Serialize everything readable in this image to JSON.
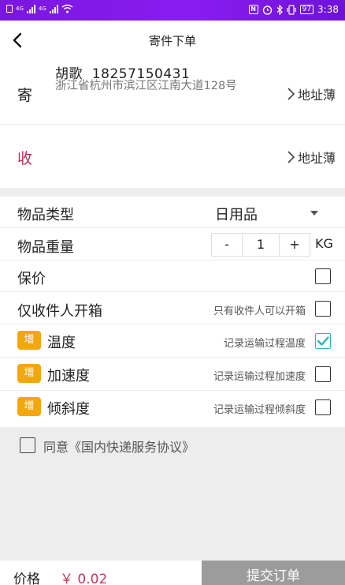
{
  "status_bar": {
    "time": "3:38",
    "battery": "97",
    "net1": "4G",
    "net2": "4G",
    "nfc": "N"
  },
  "header": {
    "title": "寄件下单"
  },
  "sender": {
    "label": "寄",
    "name_phone": "胡歌  18257150431",
    "address": "浙江省杭州市滨江区江南大道128号",
    "address_book": "地址薄"
  },
  "receiver": {
    "label": "收",
    "address_book": "地址薄"
  },
  "item": {
    "type_label": "物品类型",
    "type_value": "日用品",
    "weight_label": "物品重量",
    "weight_minus": "-",
    "weight_value": "1",
    "weight_plus": "+",
    "weight_unit": "KG",
    "insured_label": "保价",
    "insured_checked": false,
    "recipient_only_label": "仅收件人开箱",
    "recipient_only_hint": "只有收件人可以开箱",
    "recipient_only_checked": false
  },
  "addons": [
    {
      "badge": "增",
      "label": "温度",
      "hint": "记录运输过程温度",
      "checked": true
    },
    {
      "badge": "增",
      "label": "加速度",
      "hint": "记录运输过程加速度",
      "checked": false
    },
    {
      "badge": "增",
      "label": "倾斜度",
      "hint": "记录运输过程倾斜度",
      "checked": false
    }
  ],
  "agreement": {
    "text": "同意《国内快递服务协议》",
    "checked": false
  },
  "footer": {
    "price_label": "价格",
    "price_value": "￥ 0.02",
    "submit_label": "提交订单"
  },
  "colors": {
    "status_bar": "#8a1cf0",
    "accent_red": "#c0395f",
    "badge": "#f2a70f",
    "check": "#2bb5bd",
    "submit_bg": "#9c9c9c"
  }
}
